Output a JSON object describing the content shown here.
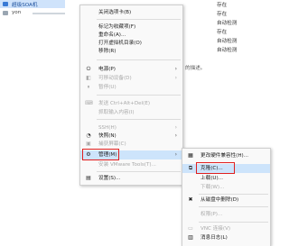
{
  "background": {
    "selected_vm": "超级SOA机",
    "second_vm": "yon",
    "statuses": [
      "存在",
      "存在",
      "自动检测",
      "存在",
      "自动检测",
      "自动检测"
    ],
    "description_fragment": "的描述。"
  },
  "context_menu": {
    "items": [
      {
        "label": "关闭选项卡(B)",
        "icon": "",
        "enabled": true
      },
      {
        "label": "标记为收藏项(F)",
        "icon": "",
        "enabled": true
      },
      {
        "label": "重命名(A)...",
        "icon": "",
        "enabled": true
      },
      {
        "label": "打开虚拟机目录(O)",
        "icon": "",
        "enabled": true
      },
      {
        "label": "移除(R)",
        "icon": "",
        "enabled": true
      },
      {
        "label": "电源(P)",
        "icon": "power-icon",
        "enabled": true,
        "submenu": true
      },
      {
        "label": "可移动设备(D)",
        "icon": "usb-icon",
        "enabled": false,
        "submenu": true
      },
      {
        "label": "暂停(U)",
        "icon": "pause-icon",
        "enabled": false
      },
      {
        "label": "发送 Ctrl+Alt+Del(E)",
        "icon": "keyboard-icon",
        "enabled": false
      },
      {
        "label": "抓取输入内容(I)",
        "icon": "",
        "enabled": false
      },
      {
        "label": "SSH(H)",
        "icon": "",
        "enabled": false,
        "submenu": true
      },
      {
        "label": "快照(N)",
        "icon": "snapshot-icon",
        "enabled": true,
        "submenu": true
      },
      {
        "label": "捕获屏幕(C)",
        "icon": "camera-icon",
        "enabled": false
      },
      {
        "label": "管理(M)",
        "icon": "wrench-icon",
        "enabled": true,
        "submenu": true
      },
      {
        "label": "安装 VMware Tools(T)...",
        "icon": "",
        "enabled": false
      },
      {
        "label": "设置(S)...",
        "icon": "settings-icon",
        "enabled": true
      }
    ]
  },
  "manage_submenu": {
    "items": [
      {
        "label": "更改硬件兼容性(H)...",
        "icon": "hardware-icon",
        "enabled": true
      },
      {
        "label": "克隆(C)...",
        "icon": "clone-icon",
        "enabled": true
      },
      {
        "label": "上载(U)...",
        "icon": "",
        "enabled": true
      },
      {
        "label": "下载(W)...",
        "icon": "",
        "enabled": false
      },
      {
        "label": "从磁盘中删除(D)",
        "icon": "delete-icon",
        "enabled": true
      },
      {
        "label": "权限(P)...",
        "icon": "",
        "enabled": false
      },
      {
        "label": "VNC 连接(V)",
        "icon": "vnc-icon",
        "enabled": false
      },
      {
        "label": "消息日志(L)",
        "icon": "log-icon",
        "enabled": true
      }
    ]
  },
  "icons": {
    "power-icon": "⏻",
    "usb-icon": "◧",
    "pause-icon": "⏸",
    "keyboard-icon": "⌨",
    "snapshot-icon": "◔",
    "camera-icon": "▣",
    "wrench-icon": "⚙",
    "settings-icon": "▤",
    "hardware-icon": "▦",
    "clone-icon": "⧉",
    "delete-icon": "✖",
    "vnc-icon": "▭",
    "log-icon": "▥",
    "arrow": "›"
  },
  "colors": {
    "highlight": "#cde4fb",
    "redbox": "#e02020"
  }
}
